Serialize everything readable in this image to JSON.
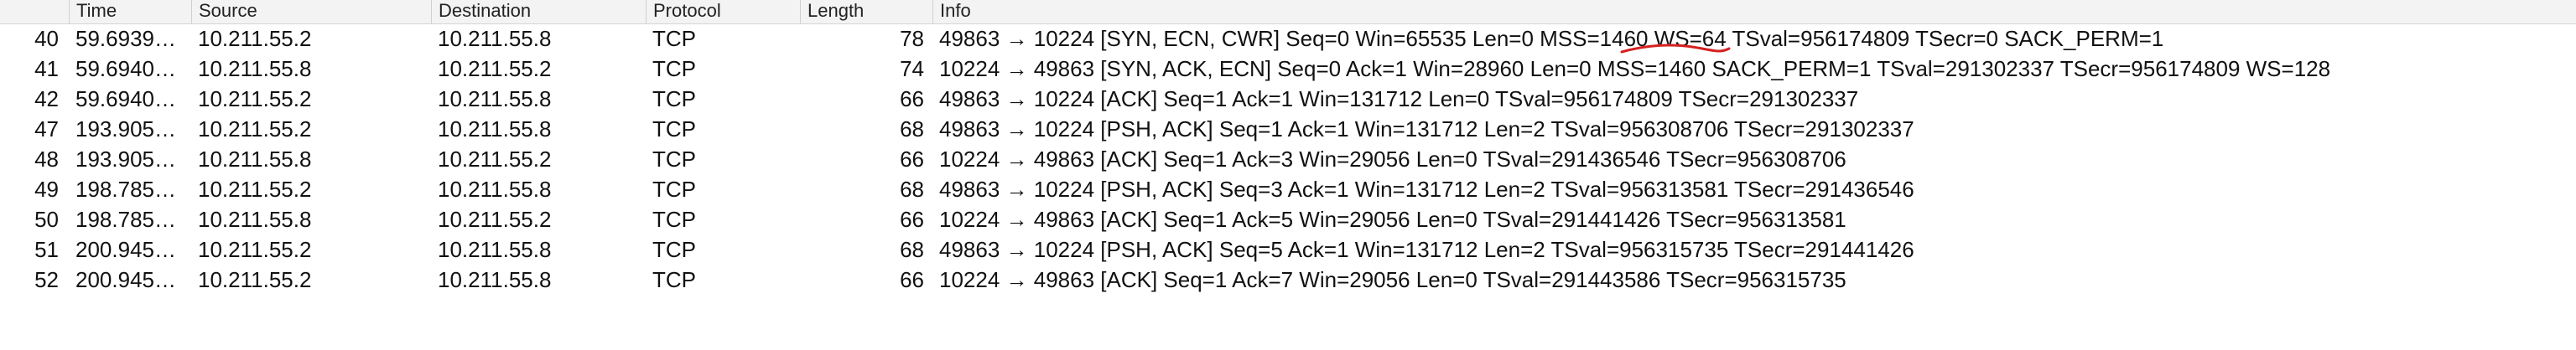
{
  "columns": {
    "no": "",
    "time": "Time",
    "source": "Source",
    "destination": "Destination",
    "protocol": "Protocol",
    "length": "Length",
    "info": "Info"
  },
  "annotation": {
    "color": "#d62020",
    "target_text": "MSS=1460"
  },
  "packets": [
    {
      "no": "40",
      "time": "59.6939…",
      "source": "10.211.55.2",
      "destination": "10.211.55.8",
      "protocol": "TCP",
      "length": "78",
      "info": "49863 → 10224 [SYN, ECN, CWR] Seq=0 Win=65535 Len=0 MSS=1460 WS=64 TSval=956174809 TSecr=0 SACK_PERM=1"
    },
    {
      "no": "41",
      "time": "59.6940…",
      "source": "10.211.55.8",
      "destination": "10.211.55.2",
      "protocol": "TCP",
      "length": "74",
      "info": "10224 → 49863 [SYN, ACK, ECN] Seq=0 Ack=1 Win=28960 Len=0 MSS=1460 SACK_PERM=1 TSval=291302337 TSecr=956174809 WS=128"
    },
    {
      "no": "42",
      "time": "59.6940…",
      "source": "10.211.55.2",
      "destination": "10.211.55.8",
      "protocol": "TCP",
      "length": "66",
      "info": "49863 → 10224 [ACK] Seq=1 Ack=1 Win=131712 Len=0 TSval=956174809 TSecr=291302337"
    },
    {
      "no": "47",
      "time": "193.905…",
      "source": "10.211.55.2",
      "destination": "10.211.55.8",
      "protocol": "TCP",
      "length": "68",
      "info": "49863 → 10224 [PSH, ACK] Seq=1 Ack=1 Win=131712 Len=2 TSval=956308706 TSecr=291302337"
    },
    {
      "no": "48",
      "time": "193.905…",
      "source": "10.211.55.8",
      "destination": "10.211.55.2",
      "protocol": "TCP",
      "length": "66",
      "info": "10224 → 49863 [ACK] Seq=1 Ack=3 Win=29056 Len=0 TSval=291436546 TSecr=956308706"
    },
    {
      "no": "49",
      "time": "198.785…",
      "source": "10.211.55.2",
      "destination": "10.211.55.8",
      "protocol": "TCP",
      "length": "68",
      "info": "49863 → 10224 [PSH, ACK] Seq=3 Ack=1 Win=131712 Len=2 TSval=956313581 TSecr=291436546"
    },
    {
      "no": "50",
      "time": "198.785…",
      "source": "10.211.55.8",
      "destination": "10.211.55.2",
      "protocol": "TCP",
      "length": "66",
      "info": "10224 → 49863 [ACK] Seq=1 Ack=5 Win=29056 Len=0 TSval=291441426 TSecr=956313581"
    },
    {
      "no": "51",
      "time": "200.945…",
      "source": "10.211.55.2",
      "destination": "10.211.55.8",
      "protocol": "TCP",
      "length": "68",
      "info": "49863 → 10224 [PSH, ACK] Seq=5 Ack=1 Win=131712 Len=2 TSval=956315735 TSecr=291441426"
    },
    {
      "no": "52",
      "time": "200.945…",
      "source": "10.211.55.2",
      "destination": "10.211.55.8",
      "protocol": "TCP",
      "length": "66",
      "info": "10224 → 49863 [ACK] Seq=1 Ack=7 Win=29056 Len=0 TSval=291443586 TSecr=956315735"
    }
  ]
}
